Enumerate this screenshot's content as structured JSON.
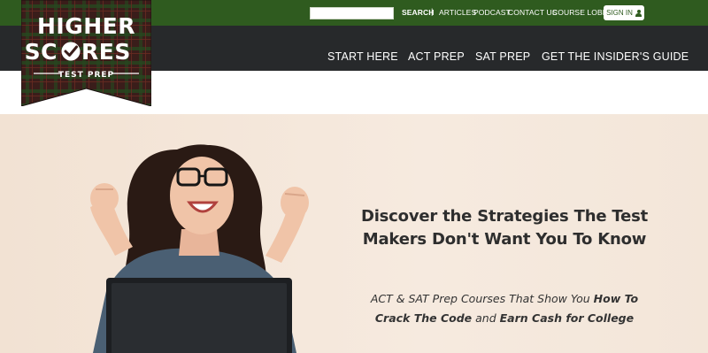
{
  "utility": {
    "search_placeholder": "",
    "search_label": "SEARCH",
    "separator": "|",
    "links": [
      "ARTICLES",
      "PODCAST",
      "CONTACT US",
      "COURSE LOBBY"
    ],
    "signin_label": "SIGN IN",
    "signin_icon": "user-icon"
  },
  "logo": {
    "line1": "HIGHER",
    "line2_a": "SC",
    "line2_b": "RES",
    "tagline": "TEST PREP",
    "icon": "checkmark-icon"
  },
  "nav": {
    "items": [
      "START HERE",
      "ACT PREP",
      "SAT PREP",
      "GET THE INSIDER'S GUIDE"
    ]
  },
  "hero": {
    "heading": "Discover the Strategies The Test Makers Don't Want You To Know",
    "sub_1": "ACT & SAT Prep Courses That Show You ",
    "sub_2": "How To Crack The Code",
    "sub_3": " and ",
    "sub_4": "Earn Cash for College"
  },
  "colors": {
    "topbar": "#2f5b1f",
    "navbar": "#27292b",
    "hero_bg": "#f3e5d7",
    "logo_plaid": "#3b1e1a"
  }
}
